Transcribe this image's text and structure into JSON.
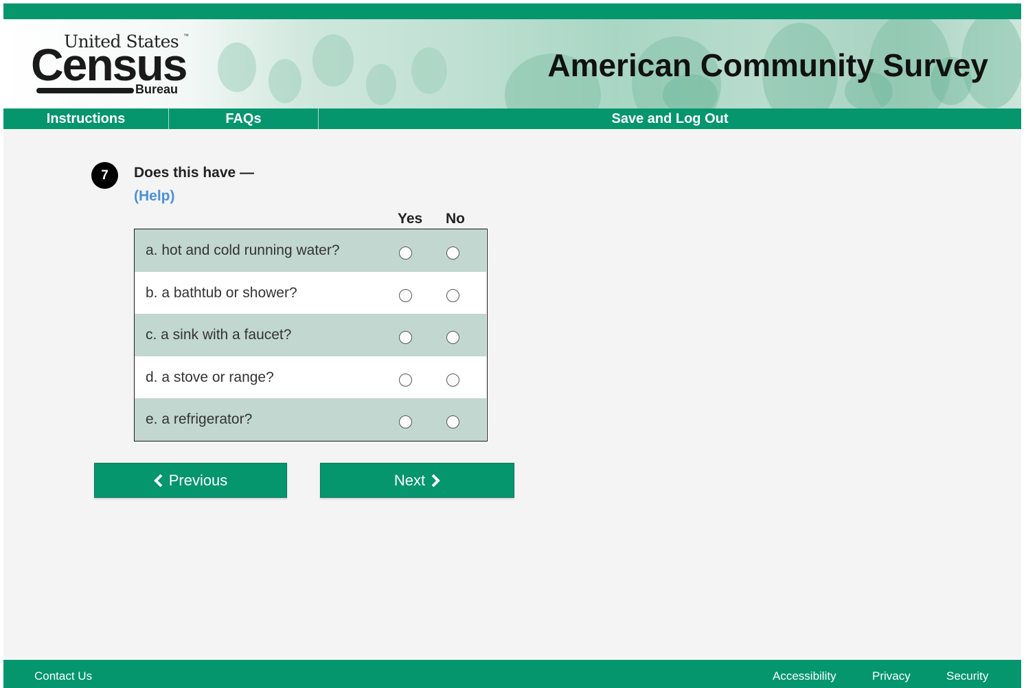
{
  "header": {
    "logo": {
      "united_states": "United States",
      "tm": "™",
      "census": "Census",
      "bureau": "Bureau"
    },
    "survey_title": "American Community Survey"
  },
  "nav": {
    "instructions": "Instructions",
    "faqs": "FAQs",
    "save_logout": "Save and Log Out"
  },
  "question": {
    "number": "7",
    "text": "Does this have —",
    "help": "(Help)",
    "columns": {
      "yes": "Yes",
      "no": "No"
    },
    "items": [
      {
        "label": "a. hot and cold running water?"
      },
      {
        "label": "b. a bathtub or shower?"
      },
      {
        "label": "c. a sink with a faucet?"
      },
      {
        "label": "d. a stove or range?"
      },
      {
        "label": "e. a refrigerator?"
      }
    ]
  },
  "buttons": {
    "previous": "Previous",
    "next": "Next"
  },
  "footer": {
    "contact": "Contact Us",
    "accessibility": "Accessibility",
    "privacy": "Privacy",
    "security": "Security"
  },
  "colors": {
    "brand_green": "#05966e",
    "row_shade": "#c2d7cf",
    "help_link": "#4a90d9"
  }
}
